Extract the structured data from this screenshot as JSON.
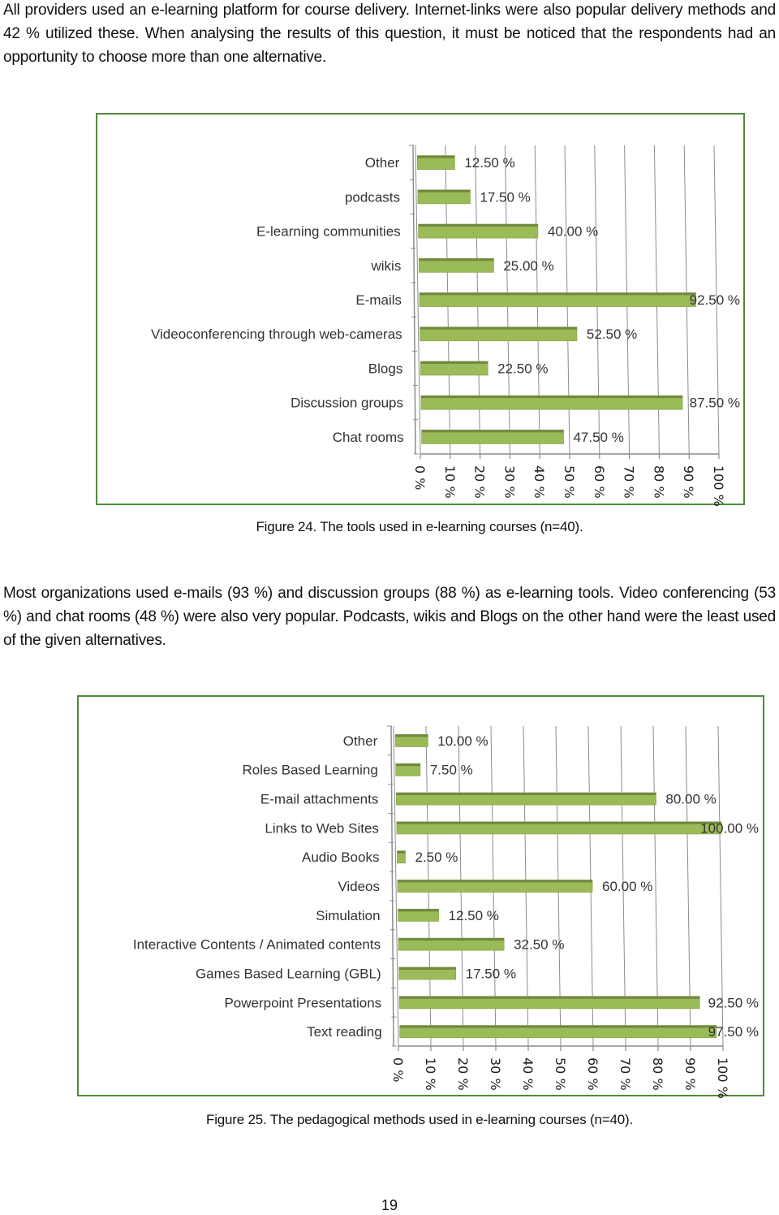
{
  "page": {
    "paragraph_1": "All providers used an e-learning platform for course delivery. Internet-links were also popular delivery methods and 42 % utilized these. When analysing the results of this question, it must be noticed that the respondents had an opportunity to choose more than one alternative.",
    "caption_1": "Figure 24. The tools used in e-learning courses (n=40).",
    "paragraph_2": "Most organizations used e-mails (93 %) and discussion groups (88 %) as e-learning tools.  Video conferencing  (53 %) and chat rooms (48 %) were also very popular. Podcasts, wikis and Blogs on the other hand were the least used of the given alternatives.",
    "caption_2": "Figure 25. The pedagogical methods used in e-learning courses (n=40).",
    "page_number": "19"
  },
  "colors": {
    "bar_fill": "#9bbb59",
    "bar_top": "#71893f",
    "frame_border": "#4f8a3c",
    "grid": "#8c8c8c"
  },
  "chart_data": [
    {
      "type": "bar",
      "orientation": "horizontal",
      "title": "",
      "caption": "Figure 24. The tools used in e-learning courses (n=40).",
      "categories": [
        "Other",
        "podcasts",
        "E-learning communities",
        "wikis",
        "E-mails",
        "Videoconferencing through web-cameras",
        "Blogs",
        "Discussion groups",
        "Chat rooms"
      ],
      "values": [
        12.5,
        17.5,
        40.0,
        25.0,
        92.5,
        52.5,
        22.5,
        87.5,
        47.5
      ],
      "data_labels": [
        "12.50 %",
        "17.50 %",
        "40.00 %",
        "25.00 %",
        "92.50 %",
        "52.50 %",
        "22.50 %",
        "87.50 %",
        "47.50 %"
      ],
      "xlabel": "",
      "ylabel": "",
      "xlim": [
        0,
        100
      ],
      "x_ticks": [
        "0 %",
        "10 %",
        "20 %",
        "30 %",
        "40 %",
        "50 %",
        "60 %",
        "70 %",
        "80 %",
        "90 %",
        "100 %"
      ],
      "grid": true,
      "legend": "none"
    },
    {
      "type": "bar",
      "orientation": "horizontal",
      "title": "",
      "caption": "Figure 25. The pedagogical methods used in e-learning courses (n=40).",
      "categories": [
        "Other",
        "Roles Based  Learning",
        "E-mail attachments",
        "Links to Web Sites",
        "Audio Books",
        "Videos",
        "Simulation",
        "Interactive Contents / Animated contents",
        "Games Based Learning (GBL)",
        "Powerpoint Presentations",
        "Text reading"
      ],
      "values": [
        10.0,
        7.5,
        80.0,
        100.0,
        2.5,
        60.0,
        12.5,
        32.5,
        17.5,
        92.5,
        97.5
      ],
      "data_labels": [
        "10.00 %",
        "7.50 %",
        "80.00 %",
        "100.00 %",
        "2.50 %",
        "60.00 %",
        "12.50 %",
        "32.50 %",
        "17.50 %",
        "92.50 %",
        "97.50 %"
      ],
      "xlabel": "",
      "ylabel": "",
      "xlim": [
        0,
        100
      ],
      "x_ticks": [
        "0 %",
        "10 %",
        "20 %",
        "30 %",
        "40 %",
        "50 %",
        "60 %",
        "70 %",
        "80 %",
        "90 %",
        "100 %"
      ],
      "grid": true,
      "legend": "none"
    }
  ]
}
